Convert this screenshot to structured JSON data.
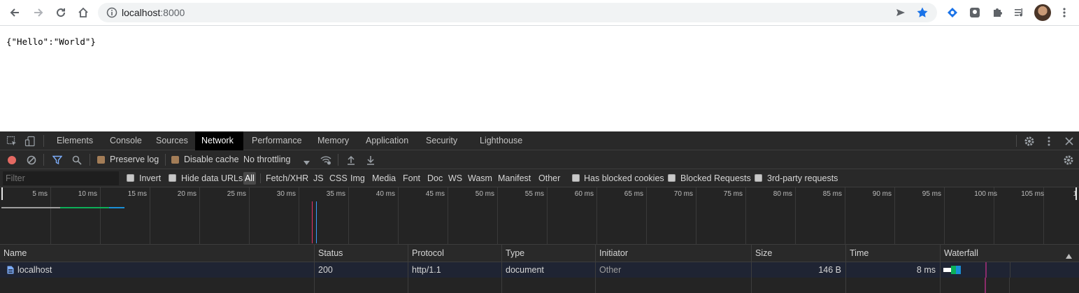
{
  "browser": {
    "url_host": "localhost",
    "url_port": ":8000"
  },
  "page": {
    "json_text": "{\"Hello\":\"World\"}"
  },
  "devtools": {
    "tabs": [
      "Elements",
      "Console",
      "Sources",
      "Network",
      "Performance",
      "Memory",
      "Application",
      "Security",
      "Lighthouse"
    ],
    "active_tab": "Network",
    "toolbar": {
      "preserve_log": "Preserve log",
      "preserve_log_checked": true,
      "disable_cache": "Disable cache",
      "disable_cache_checked": true,
      "throttling": "No throttling"
    },
    "filter": {
      "placeholder": "Filter",
      "invert": "Invert",
      "hide_data_urls": "Hide data URLs",
      "types": [
        "All",
        "Fetch/XHR",
        "JS",
        "CSS",
        "Img",
        "Media",
        "Font",
        "Doc",
        "WS",
        "Wasm",
        "Manifest",
        "Other"
      ],
      "active_type": "All",
      "has_blocked_cookies": "Has blocked cookies",
      "blocked_requests": "Blocked Requests",
      "third_party": "3rd-party requests"
    },
    "timeline": {
      "ticks": [
        "5 ms",
        "10 ms",
        "15 ms",
        "20 ms",
        "25 ms",
        "30 ms",
        "35 ms",
        "40 ms",
        "45 ms",
        "50 ms",
        "55 ms",
        "60 ms",
        "65 ms",
        "70 ms",
        "75 ms",
        "80 ms",
        "85 ms",
        "90 ms",
        "95 ms",
        "100 ms",
        "105 ms",
        "1"
      ]
    },
    "table": {
      "columns": [
        "Name",
        "Status",
        "Protocol",
        "Type",
        "Initiator",
        "Size",
        "Time",
        "Waterfall"
      ],
      "rows": [
        {
          "name": "localhost",
          "status": "200",
          "protocol": "http/1.1",
          "type": "document",
          "initiator": "Other",
          "size": "146 B",
          "time": "8 ms"
        }
      ]
    },
    "colors": {
      "record": "#e46962",
      "active_tab_bg": "#000000",
      "row_bg": "#1f2433",
      "waterfall_green": "#0caf58",
      "waterfall_blue": "#1a8fd6"
    }
  }
}
